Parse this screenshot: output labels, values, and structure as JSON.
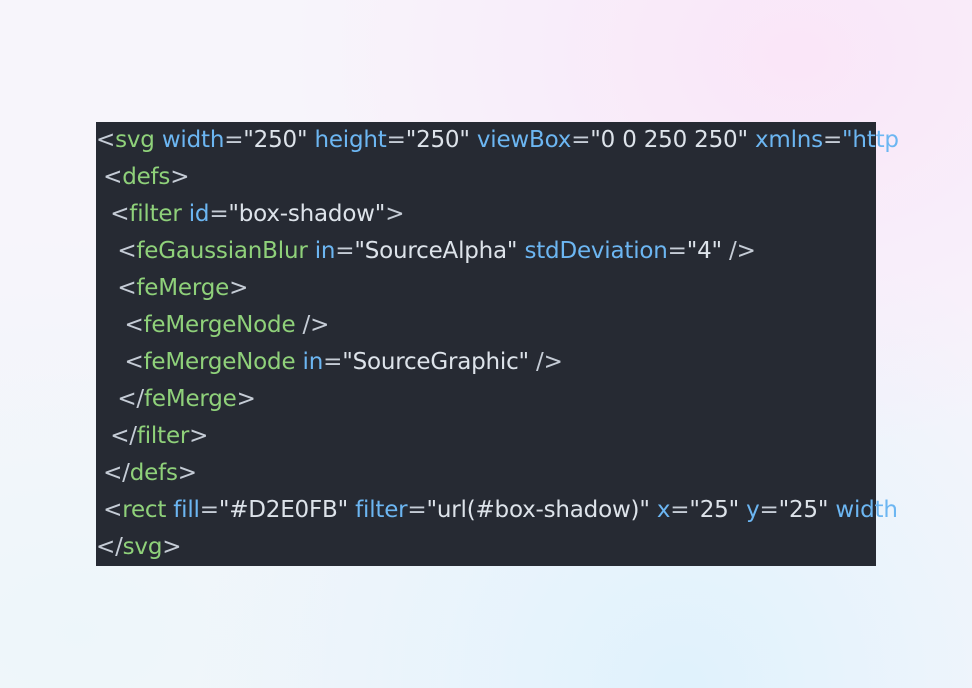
{
  "editor": {
    "language": "svg",
    "colors": {
      "background": "#262a33",
      "punctuation": "#c5ccd6",
      "tag": "#8fd17a",
      "attribute": "#6cb6f2",
      "string": "#dde3ea"
    },
    "lines": [
      {
        "tokens": [
          {
            "type": "punct",
            "text": "<"
          },
          {
            "type": "tag",
            "text": "svg"
          },
          {
            "type": "punct",
            "text": " "
          },
          {
            "type": "attr",
            "text": "width"
          },
          {
            "type": "punct",
            "text": "="
          },
          {
            "type": "str",
            "text": "\"250\""
          },
          {
            "type": "punct",
            "text": " "
          },
          {
            "type": "attr",
            "text": "height"
          },
          {
            "type": "punct",
            "text": "="
          },
          {
            "type": "str",
            "text": "\"250\""
          },
          {
            "type": "punct",
            "text": " "
          },
          {
            "type": "attr",
            "text": "viewBox"
          },
          {
            "type": "punct",
            "text": "="
          },
          {
            "type": "str",
            "text": "\"0 0 250 250\""
          },
          {
            "type": "punct",
            "text": " "
          },
          {
            "type": "attr",
            "text": "xmlns"
          },
          {
            "type": "punct",
            "text": "="
          },
          {
            "type": "attr",
            "text": "\"http"
          }
        ]
      },
      {
        "tokens": [
          {
            "type": "punct",
            "text": " <"
          },
          {
            "type": "tag",
            "text": "defs"
          },
          {
            "type": "punct",
            "text": ">"
          }
        ]
      },
      {
        "tokens": [
          {
            "type": "punct",
            "text": "  <"
          },
          {
            "type": "tag",
            "text": "filter"
          },
          {
            "type": "punct",
            "text": " "
          },
          {
            "type": "attr",
            "text": "id"
          },
          {
            "type": "punct",
            "text": "="
          },
          {
            "type": "str",
            "text": "\"box-shadow\""
          },
          {
            "type": "punct",
            "text": ">"
          }
        ]
      },
      {
        "tokens": [
          {
            "type": "punct",
            "text": "   <"
          },
          {
            "type": "tag",
            "text": "feGaussianBlur"
          },
          {
            "type": "punct",
            "text": " "
          },
          {
            "type": "attr",
            "text": "in"
          },
          {
            "type": "punct",
            "text": "="
          },
          {
            "type": "str",
            "text": "\"SourceAlpha\""
          },
          {
            "type": "punct",
            "text": " "
          },
          {
            "type": "attr",
            "text": "stdDeviation"
          },
          {
            "type": "punct",
            "text": "="
          },
          {
            "type": "str",
            "text": "\"4\""
          },
          {
            "type": "punct",
            "text": " />"
          }
        ]
      },
      {
        "tokens": [
          {
            "type": "punct",
            "text": "   <"
          },
          {
            "type": "tag",
            "text": "feMerge"
          },
          {
            "type": "punct",
            "text": ">"
          }
        ]
      },
      {
        "tokens": [
          {
            "type": "punct",
            "text": "    <"
          },
          {
            "type": "tag",
            "text": "feMergeNode"
          },
          {
            "type": "punct",
            "text": " />"
          }
        ]
      },
      {
        "tokens": [
          {
            "type": "punct",
            "text": "    <"
          },
          {
            "type": "tag",
            "text": "feMergeNode"
          },
          {
            "type": "punct",
            "text": " "
          },
          {
            "type": "attr",
            "text": "in"
          },
          {
            "type": "punct",
            "text": "="
          },
          {
            "type": "str",
            "text": "\"SourceGraphic\""
          },
          {
            "type": "punct",
            "text": " />"
          }
        ]
      },
      {
        "tokens": [
          {
            "type": "punct",
            "text": "   </"
          },
          {
            "type": "tag",
            "text": "feMerge"
          },
          {
            "type": "punct",
            "text": ">"
          }
        ]
      },
      {
        "tokens": [
          {
            "type": "punct",
            "text": "  </"
          },
          {
            "type": "tag",
            "text": "filter"
          },
          {
            "type": "punct",
            "text": ">"
          }
        ]
      },
      {
        "tokens": [
          {
            "type": "punct",
            "text": " </"
          },
          {
            "type": "tag",
            "text": "defs"
          },
          {
            "type": "punct",
            "text": ">"
          }
        ]
      },
      {
        "tokens": [
          {
            "type": "punct",
            "text": " <"
          },
          {
            "type": "tag",
            "text": "rect"
          },
          {
            "type": "punct",
            "text": " "
          },
          {
            "type": "attr",
            "text": "fill"
          },
          {
            "type": "punct",
            "text": "="
          },
          {
            "type": "str",
            "text": "\"#D2E0FB\""
          },
          {
            "type": "punct",
            "text": " "
          },
          {
            "type": "attr",
            "text": "filter"
          },
          {
            "type": "punct",
            "text": "="
          },
          {
            "type": "str",
            "text": "\"url(#box-shadow)\""
          },
          {
            "type": "punct",
            "text": " "
          },
          {
            "type": "attr",
            "text": "x"
          },
          {
            "type": "punct",
            "text": "="
          },
          {
            "type": "str",
            "text": "\"25\""
          },
          {
            "type": "punct",
            "text": " "
          },
          {
            "type": "attr",
            "text": "y"
          },
          {
            "type": "punct",
            "text": "="
          },
          {
            "type": "str",
            "text": "\"25\""
          },
          {
            "type": "punct",
            "text": " "
          },
          {
            "type": "attr",
            "text": "width"
          }
        ]
      },
      {
        "tokens": [
          {
            "type": "punct",
            "text": "</"
          },
          {
            "type": "tag",
            "text": "svg"
          },
          {
            "type": "punct",
            "text": ">"
          }
        ]
      }
    ]
  }
}
